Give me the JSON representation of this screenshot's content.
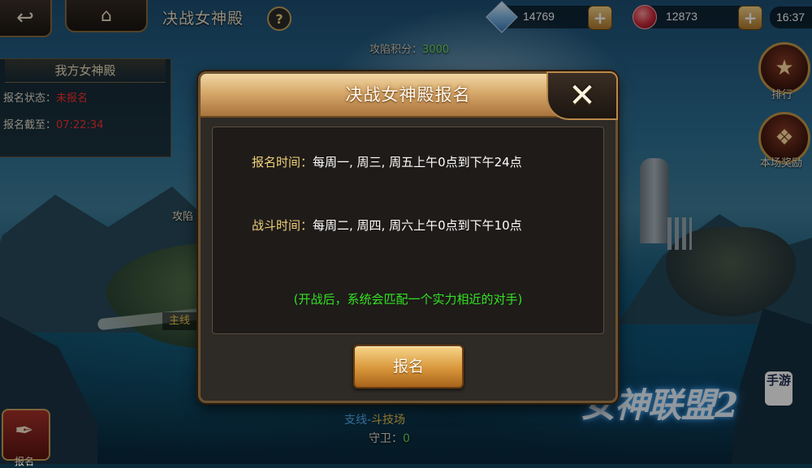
{
  "hud": {
    "back_icon": "back-arrow-icon",
    "home_icon": "home-icon",
    "title": "决战女神殿",
    "help_label": "?",
    "diamond": "14769",
    "ruby": "12873",
    "plus_label": "+",
    "time": "16:37"
  },
  "attack_score": {
    "label": "攻陷积分：",
    "value": "3000"
  },
  "left_panel": {
    "title": "我方女神殿",
    "status_label": "报名状态：",
    "status_value": "未报名",
    "deadline_label": "报名截至：",
    "deadline_value": "07:22:34"
  },
  "map_labels": {
    "attack": "攻陷",
    "main_line": "主线"
  },
  "bottom_left": {
    "label": "报名"
  },
  "side_icons": {
    "rank": "排行",
    "reward": "本场奖励"
  },
  "arena": {
    "prefix": "支线-",
    "name": "斗技场",
    "guard_label": "守卫：",
    "guard_value": "0"
  },
  "logo": {
    "text": "女神联盟2",
    "tag": "手游"
  },
  "dialog": {
    "title": "决战女神殿报名",
    "close_icon": "close-icon",
    "signup_time_label": "报名时间：",
    "signup_time_value": "每周一, 周三, 周五上午0点到下午24点",
    "battle_time_label": "战斗时间：",
    "battle_time_value": "每周二, 周四, 周六上午0点到下午10点",
    "note": "(开战后，系统会匹配一个实力相近的对手)",
    "signup_button": "报名"
  },
  "colors": {
    "accent_gold": "#d8963a",
    "note_green": "#33e022",
    "status_red": "#ff3030",
    "label_yellow": "#f2d27a"
  }
}
